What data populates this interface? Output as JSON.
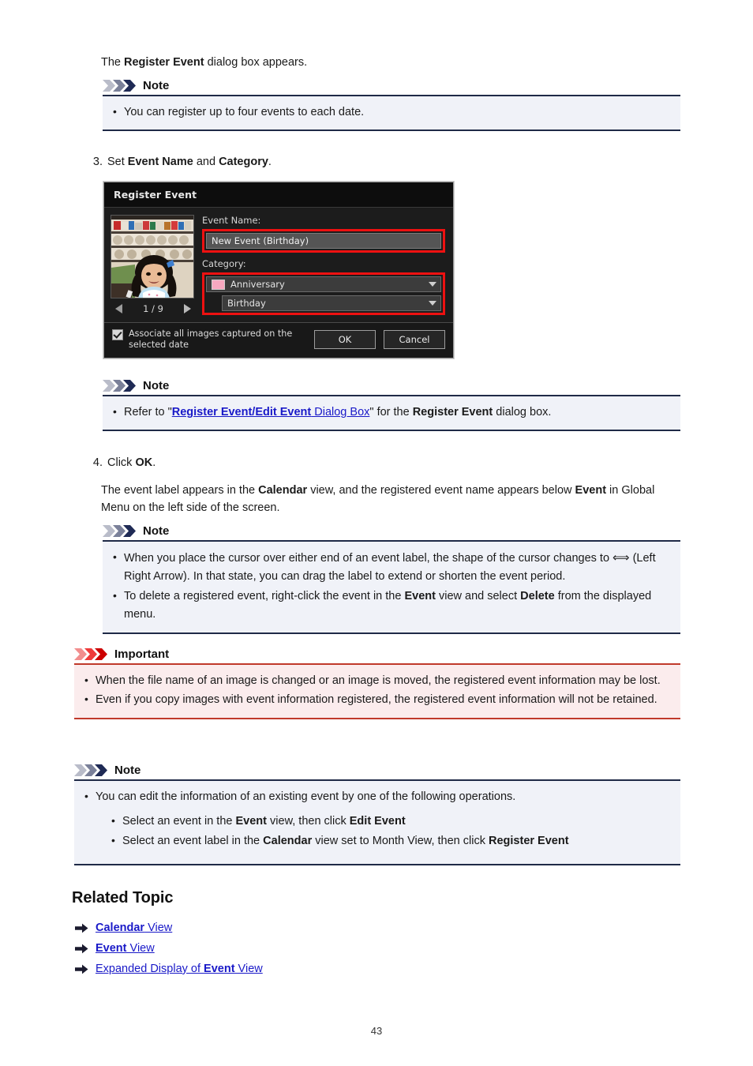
{
  "document": {
    "page_number": "43"
  },
  "intro": {
    "prefix": "The ",
    "bold": "Register Event",
    "suffix": " dialog box appears."
  },
  "note1": {
    "title": "Note",
    "icon": "chevrons-note-icon",
    "items": [
      "You can register up to four events to each date."
    ]
  },
  "step3": {
    "number": "3.",
    "prefix": "Set ",
    "bold1": "Event Name",
    "middle": " and ",
    "bold2": "Category",
    "suffix": "."
  },
  "dialog": {
    "title": "Register Event",
    "event_name_label": "Event Name:",
    "event_name_value": "New Event (Birthday)",
    "category_label": "Category:",
    "category_value": "Anniversary",
    "category_swatch_color": "#f7a8c0",
    "subcategory_value": "Birthday",
    "thumb_counter": "1 / 9",
    "prev_icon": "previous-arrow-icon",
    "next_icon": "next-arrow-icon",
    "checkbox_label": "Associate all images captured on the selected date",
    "checkbox_checked": true,
    "ok_label": "OK",
    "cancel_label": "Cancel",
    "highlight_color": "#ee1111"
  },
  "note2": {
    "title": "Note",
    "icon": "chevrons-note-icon",
    "item": {
      "prefix": "Refer to \"",
      "link_bold": "Register Event/Edit Event",
      "link_rest": " Dialog Box",
      "middle": "\" for the ",
      "bold": "Register Event",
      "suffix": " dialog box."
    }
  },
  "step4": {
    "number": "4.",
    "prefix": "Click ",
    "bold": "OK",
    "suffix": ".",
    "paragraph": {
      "p1": "The event label appears in the ",
      "b1": "Calendar",
      "p2": " view, and the registered event name appears below ",
      "b2": "Event",
      "p3": " in Global Menu on the left side of the screen."
    }
  },
  "note3": {
    "title": "Note",
    "icon": "chevrons-note-icon",
    "item1": {
      "p1": "When you place the cursor over either end of an event label, the shape of the cursor changes to ",
      "glyph": "⟺",
      "p2": " (Left Right Arrow). In that state, you can drag the label to extend or shorten the event period."
    },
    "item2": {
      "p1": "To delete a registered event, right-click the event in the ",
      "b1": "Event",
      "p2": " view and select ",
      "b2": "Delete",
      "p3": " from the displayed menu."
    }
  },
  "important": {
    "title": "Important",
    "icon": "chevrons-important-icon",
    "items": [
      "When the file name of an image is changed or an image is moved, the registered event information may be lost.",
      "Even if you copy images with event information registered, the registered event information will not be retained."
    ]
  },
  "note4": {
    "title": "Note",
    "icon": "chevrons-note-icon",
    "lead": "You can edit the information of an existing event by one of the following operations.",
    "sub1": {
      "p1": "Select an event in the ",
      "b1": "Event",
      "p2": " view, then click ",
      "b2": "Edit Event"
    },
    "sub2": {
      "p1": "Select an event label in the ",
      "b1": "Calendar",
      "p2": " view set to Month View, then click ",
      "b2": "Register Event"
    }
  },
  "related": {
    "heading": "Related Topic",
    "links": [
      {
        "bold": "Calendar",
        "rest": " View",
        "bold_first": true
      },
      {
        "bold": "Event",
        "rest": " View",
        "bold_first": true
      },
      {
        "pre": "Expanded Display of ",
        "bold": "Event",
        "rest": " View",
        "bold_first": false
      }
    ]
  }
}
